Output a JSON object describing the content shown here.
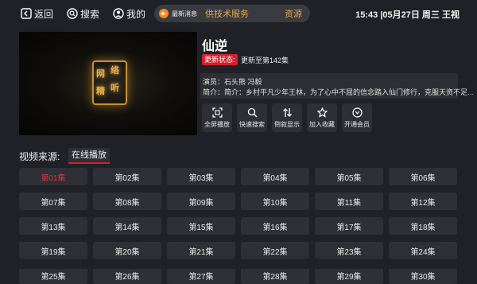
{
  "topbar": {
    "back_label": "返回",
    "search_label": "搜索",
    "mine_label": "我的",
    "news_label": "最新消息",
    "news_text": "供技术服务",
    "news_text2": "资源",
    "clock": "15:43 |05月27日 周三   王视"
  },
  "detail": {
    "title": "仙逆",
    "status_badge": "更新状态:",
    "status_text": "更新至第142集",
    "cast": "演员：石头熊 冯毅",
    "intro": "简介：简介：乡村平凡少年王林，为了心中不屈的信念踏入仙门修行，克服天资不足..."
  },
  "poster": {
    "glyphs": [
      "网",
      "络",
      "精",
      "听"
    ]
  },
  "actions": [
    {
      "label": "全屏播放",
      "icon": "fullscreen-icon"
    },
    {
      "label": "快速搜索",
      "icon": "search-icon"
    },
    {
      "label": "倒叙显示",
      "icon": "sort-icon"
    },
    {
      "label": "加入收藏",
      "icon": "star-icon"
    },
    {
      "label": "开通会员",
      "icon": "vip-icon"
    }
  ],
  "source": {
    "label": "视频来源:",
    "tab": "在线播放"
  },
  "episodes": [
    "第01集",
    "第02集",
    "第03集",
    "第04集",
    "第05集",
    "第06集",
    "第07集",
    "第08集",
    "第09集",
    "第10集",
    "第11集",
    "第12集",
    "第13集",
    "第14集",
    "第15集",
    "第16集",
    "第17集",
    "第18集",
    "第19集",
    "第20集",
    "第21集",
    "第22集",
    "第23集",
    "第24集",
    "第25集",
    "第26集",
    "第27集",
    "第28集",
    "第29集",
    "第30集"
  ],
  "colors": {
    "accent": "#d3212b",
    "news": "#e6a64a",
    "background": "#1f2127"
  }
}
